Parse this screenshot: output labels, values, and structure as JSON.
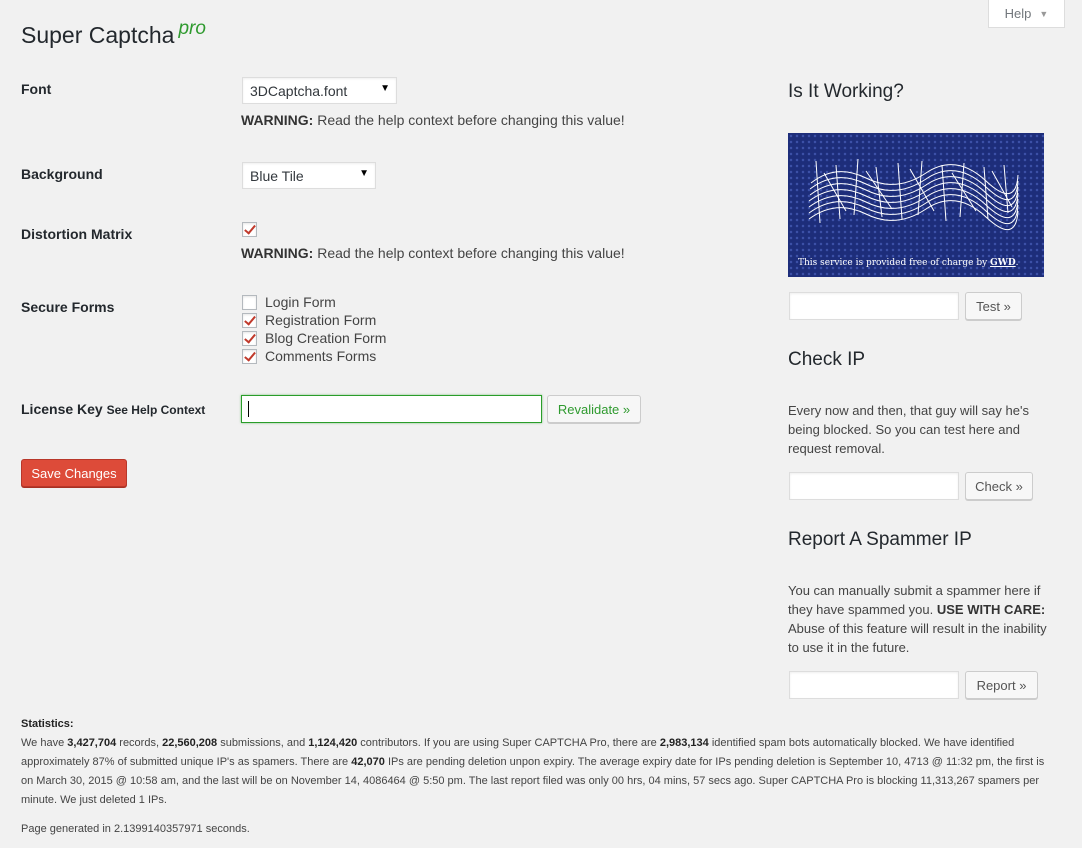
{
  "help_tab": {
    "label": "Help"
  },
  "header": {
    "title": "Super Captcha",
    "title_suffix": "pro"
  },
  "form": {
    "font": {
      "label": "Font",
      "value": "3DCaptcha.font"
    },
    "font_warning": {
      "bold": "WARNING:",
      "text": " Read the help context before changing this value!"
    },
    "background": {
      "label": "Background",
      "value": "Blue Tile"
    },
    "distortion": {
      "label": "Distortion Matrix",
      "checked": true
    },
    "distortion_warning": {
      "bold": "WARNING:",
      "text": " Read the help context before changing this value!"
    },
    "secure_forms": {
      "label": "Secure Forms",
      "items": [
        {
          "label": "Login Form",
          "checked": false
        },
        {
          "label": "Registration Form",
          "checked": true
        },
        {
          "label": "Blog Creation Form",
          "checked": true
        },
        {
          "label": "Comments Forms",
          "checked": true
        }
      ]
    },
    "license": {
      "label": "License Key",
      "help_link": "See Help Context",
      "value": "",
      "revalidate_label": "Revalidate »"
    },
    "save_label": "Save Changes"
  },
  "sidebar": {
    "working": {
      "heading": "Is It Working?",
      "captcha_credit": "This service is provided free of charge by",
      "captcha_credit_link": "GWD",
      "captcha_credit_end": ".",
      "test_label": "Test »"
    },
    "check_ip": {
      "heading": "Check IP",
      "text": "Every now and then, that guy will say he's being blocked. So you can test here and request removal.",
      "button": "Check »"
    },
    "report": {
      "heading": "Report A Spammer IP",
      "text_1": "You can manually submit a spammer here if they have spammed you. ",
      "text_bold": "USE WITH CARE:",
      "text_2": " Abuse of this feature will result in the inability to use it in the future.",
      "button": "Report »"
    }
  },
  "statistics": {
    "heading": "Statistics:",
    "p1": "We have ",
    "records": "3,427,704",
    "p2": " records, ",
    "submissions": "22,560,208",
    "p3": " submissions, and ",
    "contributors": "1,124,420",
    "p4": " contributors. If you are using Super CAPTCHA Pro, there are ",
    "bots": "2,983,134",
    "p5": " identified spam bots automatically blocked. We have identified approximately 87% of submitted unique IP's as spamers. There are ",
    "pending": "42,070",
    "p6": " IPs are pending deletion unpon expiry. The average expiry date for IPs pending deletion is September 10, 4713 @ 11:32 pm, the first is on March 30, 2015 @ 10:58 am, and the last will be on November 14, 4086464 @ 5:50 pm. The last report filed was only 00 hrs, 04 mins, 57 secs ago. Super CAPTCHA Pro is blocking 11,313,267 spamers per minute. We just deleted 1 IPs."
  },
  "footer": {
    "generated": "Page generated in 2.1399140357971 seconds."
  },
  "colors": {
    "accent_green": "#2f9a2f",
    "save_red": "#dd4b39",
    "checkmark": "#c0392b",
    "captcha_bg": "#1d2d7a"
  }
}
